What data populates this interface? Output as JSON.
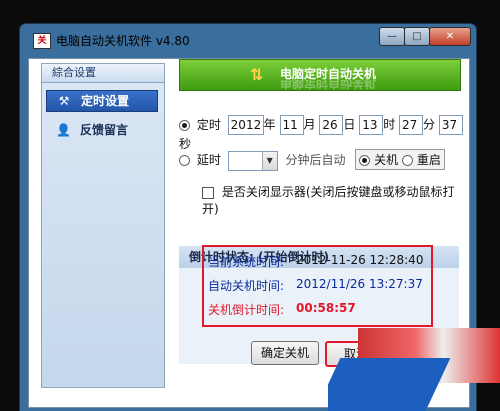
{
  "window": {
    "title": "电脑自动关机软件 v4.80",
    "app_icon_text": "关",
    "controls": {
      "minimize": "—",
      "maximize": "□",
      "close": "✕"
    }
  },
  "sidebar": {
    "header": "綜合设置",
    "items": [
      {
        "label": "定时设置",
        "icon": "wrench-icon",
        "glyph": "⚒"
      },
      {
        "label": "反馈留言",
        "icon": "user-icon",
        "glyph": "👤"
      }
    ]
  },
  "banner": {
    "title": "电脑定时自动关机",
    "icon_glyph": "⇅"
  },
  "timed": {
    "label": "定时",
    "year": "2012",
    "year_unit": "年",
    "month": "11",
    "month_unit": "月",
    "day": "26",
    "day_unit": "日",
    "hour": "13",
    "hour_unit": "时",
    "minute": "27",
    "minute_unit": "分",
    "second": "37",
    "second_unit": "秒"
  },
  "delay": {
    "label": "延时",
    "value": "",
    "suffix": "分钟后自动",
    "option_shutdown": "关机",
    "option_restart": "重启"
  },
  "monitor": {
    "label": "是否关闭显示器(关闭后按键盘或移动鼠标打开)"
  },
  "status": {
    "heading": "倒计时状态: (开始倒计时)",
    "current_label": "当前系统时间:",
    "current_value": "2012-11-26 12:28:40",
    "auto_label": "自动关机时间:",
    "auto_value": "2012/11/26 13:27:37",
    "countdown_label": "关机倒计时间:",
    "countdown_value": "00:58:57"
  },
  "buttons": {
    "confirm": "确定关机",
    "cancel": "取消"
  },
  "colors": {
    "accent_green": "#5bb51f",
    "highlight_red": "#e0192a",
    "label_blue": "#0a2a9a"
  }
}
